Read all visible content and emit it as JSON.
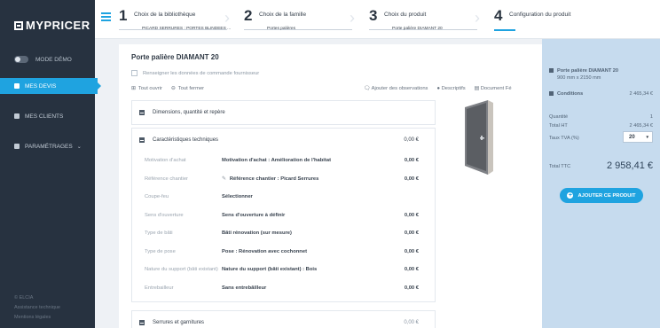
{
  "brand": {
    "logo_text": "MYPRICER",
    "accent": "#1fa3e0"
  },
  "sidebar": {
    "demo_label": "MODE DÉMO",
    "items": [
      {
        "label": "MES DEVIS",
        "icon": "file-icon",
        "active": true
      },
      {
        "label": "MES CLIENTS",
        "icon": "user-icon",
        "active": false
      },
      {
        "label": "PARAMÉTRAGES",
        "icon": "gear-icon",
        "active": false
      }
    ],
    "footer": [
      "© ELCIA",
      "Assistance technique",
      "Mentions légales"
    ]
  },
  "steps": [
    {
      "num": "1",
      "title": "Choix de la bibliothèque",
      "sub": "PICARD SERRURES : PORTES BLINDEES ..."
    },
    {
      "num": "2",
      "title": "Choix de la famille",
      "sub": "Portes palières"
    },
    {
      "num": "3",
      "title": "Choix du produit",
      "sub": "Porte palière DIAMANT 20"
    },
    {
      "num": "4",
      "title": "Configuration du produit",
      "sub": ""
    }
  ],
  "main": {
    "title": "Porte palière DIAMANT 20",
    "supplier_checkbox": "Renseigner les données de commande fournisseur",
    "open_all": "Tout ouvrir",
    "close_all": "Tout fermer",
    "add_observations": "Ajouter des observations",
    "descriptifs": "Descriptifs",
    "document": "Document Fé",
    "sections": [
      {
        "title": "Dimensions, quantité et repère",
        "price": ""
      },
      {
        "title": "Caractéristiques techniques",
        "price": "0,00 €"
      },
      {
        "title": "Serrures et garnitures",
        "price": "0,00 €"
      }
    ],
    "rows": [
      {
        "label": "Motivation d'achat",
        "value": "Motivation d'achat : Amélioration de l'habitat",
        "price": "0,00 €"
      },
      {
        "label": "Référence chantier",
        "value": "Référence chantier : Picard Serrures",
        "price": "0,00 €"
      },
      {
        "label": "Coupe-feu",
        "value": "Sélectionner",
        "price": ""
      },
      {
        "label": "Sens d'ouverture",
        "value": "Sens d'ouverture à définir",
        "price": "0,00 €"
      },
      {
        "label": "Type de bâti",
        "value": "Bâti rénovation (sur mesure)",
        "price": "0,00 €"
      },
      {
        "label": "Type de pose",
        "value": "Pose : Rénovation avec cochonnet",
        "price": "0,00 €"
      },
      {
        "label": "Nature du support (bâti existant)",
        "value": "Nature du support (bâti existant) : Bois",
        "price": "0,00 €"
      },
      {
        "label": "Entrebailleur",
        "value": "Sans entrebâilleur",
        "price": "0,00 €"
      }
    ]
  },
  "summary": {
    "product": "Porte palière DIAMANT 20",
    "dims": "900 mm x 2150 mm",
    "conditions_label": "Conditions",
    "conditions_val": "2 465,34 €",
    "quantity_label": "Quantité",
    "quantity_val": "1",
    "total_ht_label": "Total HT",
    "total_ht_val": "2 465,34 €",
    "tva_label": "Taux TVA (%)",
    "tva_val": "20",
    "ttc_label": "Total TTC",
    "ttc_val": "2 958,41 €",
    "add_button": "AJOUTER CE PRODUIT"
  }
}
